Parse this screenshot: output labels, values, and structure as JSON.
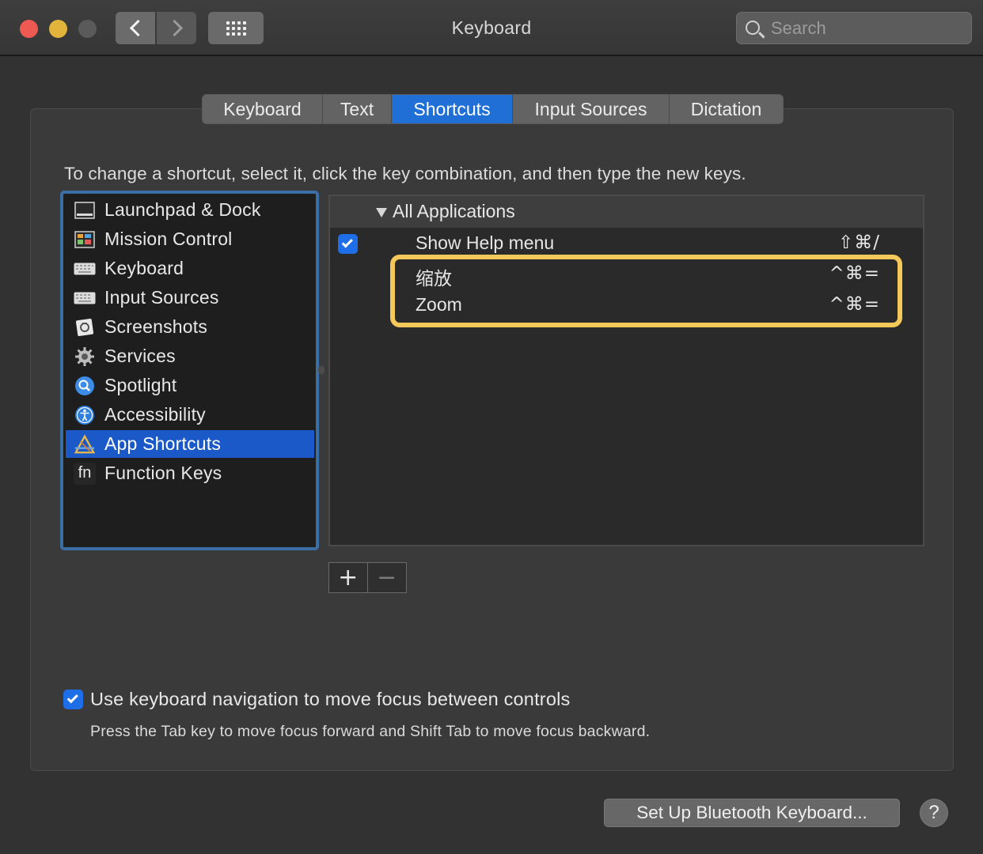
{
  "window": {
    "title": "Keyboard",
    "search_placeholder": "Search"
  },
  "tabs": [
    {
      "label": "Keyboard",
      "active": false
    },
    {
      "label": "Text",
      "active": false
    },
    {
      "label": "Shortcuts",
      "active": true
    },
    {
      "label": "Input Sources",
      "active": false
    },
    {
      "label": "Dictation",
      "active": false
    }
  ],
  "instructions": "To change a shortcut, select it, click the key combination, and then type the new keys.",
  "categories": [
    {
      "label": "Launchpad & Dock",
      "icon": "launchpad-dock-icon"
    },
    {
      "label": "Mission Control",
      "icon": "mission-control-icon"
    },
    {
      "label": "Keyboard",
      "icon": "keyboard-icon"
    },
    {
      "label": "Input Sources",
      "icon": "input-sources-icon"
    },
    {
      "label": "Screenshots",
      "icon": "screenshots-icon"
    },
    {
      "label": "Services",
      "icon": "gear-icon"
    },
    {
      "label": "Spotlight",
      "icon": "spotlight-icon"
    },
    {
      "label": "Accessibility",
      "icon": "accessibility-icon"
    },
    {
      "label": "App Shortcuts",
      "icon": "app-shortcuts-icon",
      "selected": true
    },
    {
      "label": "Function Keys",
      "icon": "fn-icon"
    }
  ],
  "shortcuts": {
    "group_label": "All Applications",
    "rows": [
      {
        "name": "Show Help menu",
        "keys": "⇧⌘/",
        "checked": true
      },
      {
        "name": "缩放",
        "keys": "^⌘=",
        "checked": null
      },
      {
        "name": "Zoom",
        "keys": "^⌘=",
        "checked": null
      }
    ]
  },
  "buttons": {
    "add": "+",
    "remove": "−",
    "bluetooth": "Set Up Bluetooth Keyboard...",
    "help": "?"
  },
  "keyboard_navigation": {
    "label": "Use keyboard navigation to move focus between controls",
    "hint": "Press the Tab key to move focus forward and Shift Tab to move focus backward.",
    "checked": true
  },
  "colors": {
    "accent": "#1b59c9",
    "highlight": "#f4c859",
    "close": "#ee5a52",
    "minimize": "#e2b43c"
  }
}
